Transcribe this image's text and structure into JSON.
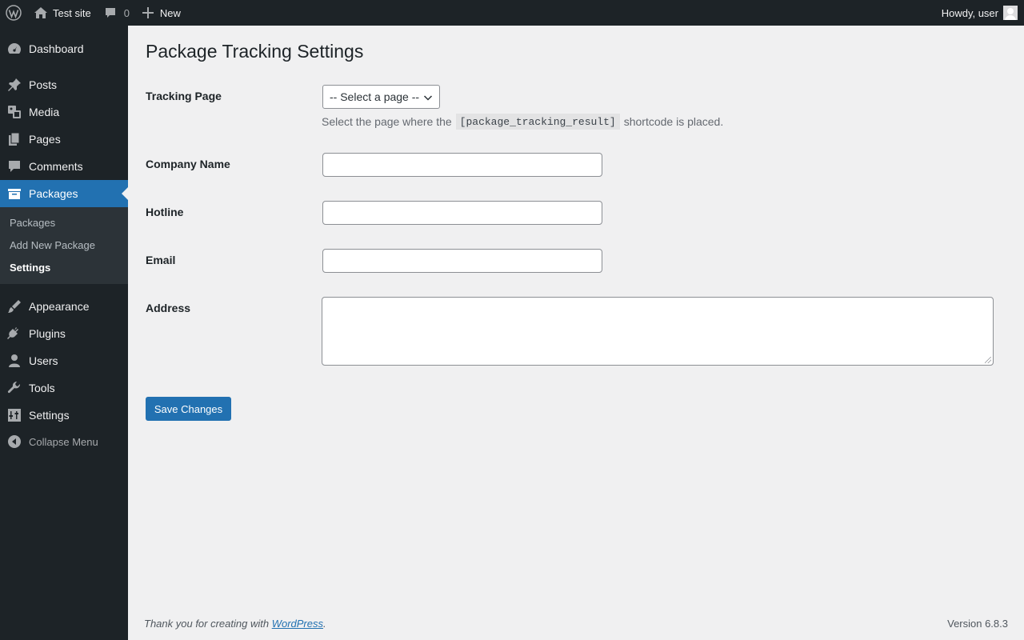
{
  "admin_bar": {
    "site_name": "Test site",
    "comments_count": "0",
    "new_label": "New",
    "greeting": "Howdy, user"
  },
  "sidebar": {
    "items": [
      {
        "label": "Dashboard",
        "icon": "dashboard-icon"
      },
      {
        "label": "Posts",
        "icon": "pin-icon"
      },
      {
        "label": "Media",
        "icon": "media-icon"
      },
      {
        "label": "Pages",
        "icon": "pages-icon"
      },
      {
        "label": "Comments",
        "icon": "comment-icon"
      },
      {
        "label": "Packages",
        "icon": "package-icon",
        "current": true
      },
      {
        "label": "Appearance",
        "icon": "paintbrush-icon"
      },
      {
        "label": "Plugins",
        "icon": "plug-icon"
      },
      {
        "label": "Users",
        "icon": "user-icon"
      },
      {
        "label": "Tools",
        "icon": "wrench-icon"
      },
      {
        "label": "Settings",
        "icon": "settings-icon"
      }
    ],
    "submenu": [
      "Packages",
      "Add New Package",
      "Settings"
    ],
    "submenu_active": "Settings",
    "collapse_label": "Collapse Menu"
  },
  "main": {
    "title": "Package Tracking Settings",
    "fields": {
      "tracking_page": {
        "label": "Tracking Page",
        "selected": "-- Select a page --"
      },
      "description_before": "Select the page where the",
      "shortcode": "[package_tracking_result]",
      "description_after": "shortcode is placed.",
      "company_name": {
        "label": "Company Name",
        "value": ""
      },
      "hotline": {
        "label": "Hotline",
        "value": ""
      },
      "email": {
        "label": "Email",
        "value": ""
      },
      "address": {
        "label": "Address",
        "value": ""
      }
    },
    "save_label": "Save Changes"
  },
  "footer": {
    "thanks_prefix": "Thank you for creating with",
    "wordpress_link": "WordPress",
    "thanks_suffix": ".",
    "version": "Version 6.8.3"
  },
  "colors": {
    "admin_bg": "#1d2327",
    "accent": "#2271b1",
    "page_bg": "#f0f0f1",
    "submenu_bg": "#2c3338"
  }
}
